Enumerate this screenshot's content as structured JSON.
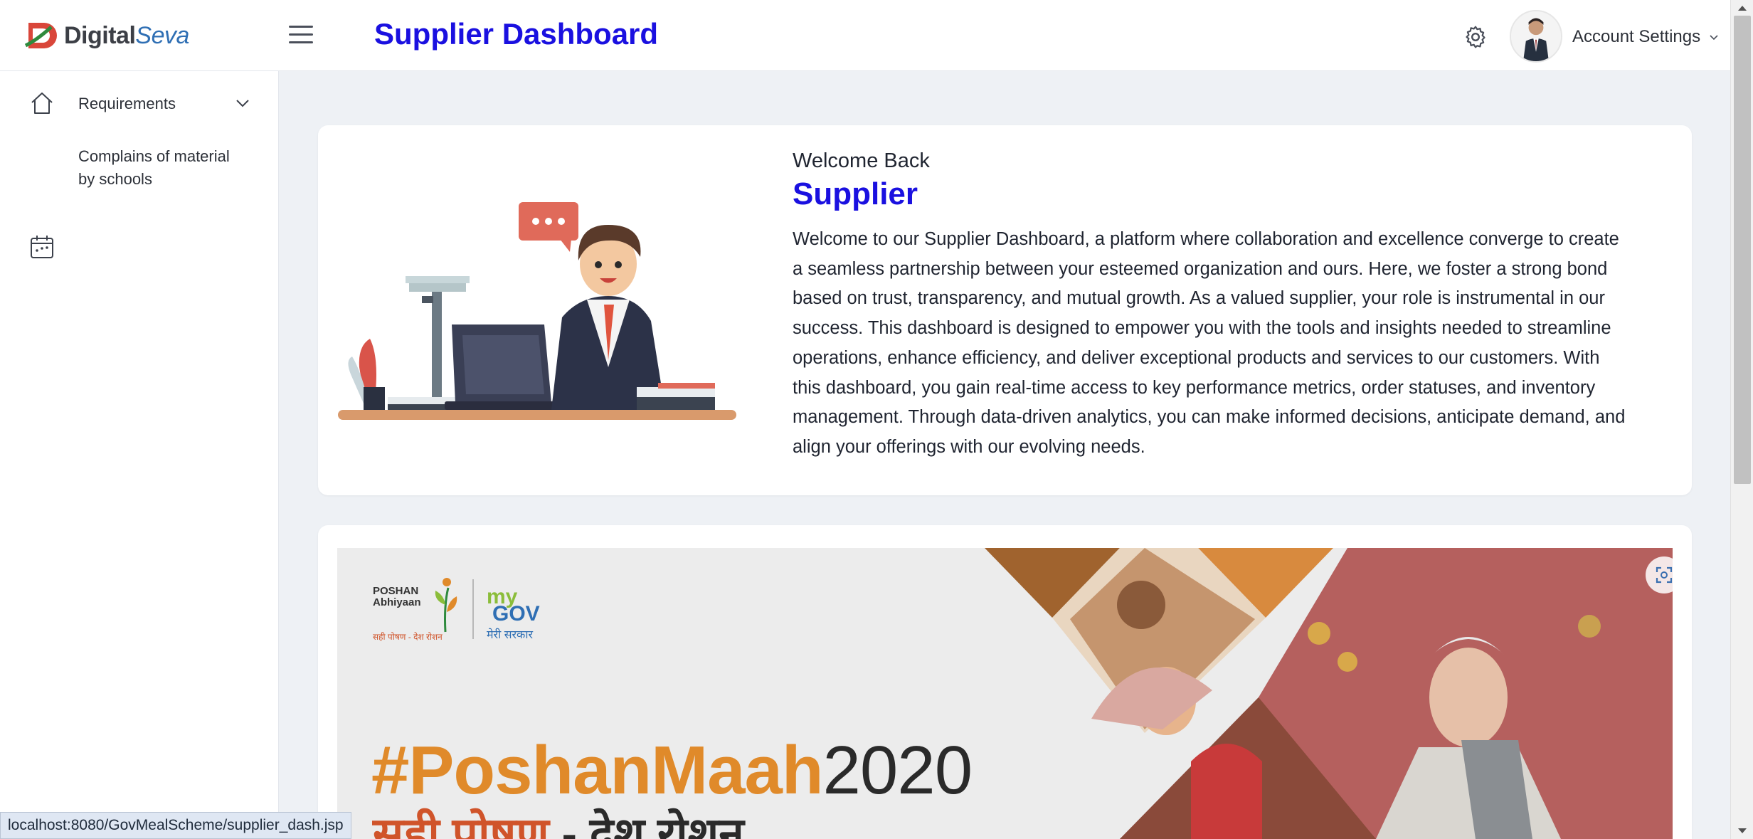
{
  "brand": {
    "name_part1": "Digital",
    "name_part2": "Seva"
  },
  "header": {
    "title": "Supplier Dashboard",
    "account_label": "Account Settings",
    "icons": [
      "menu-icon",
      "gear-icon",
      "chevron-down-icon"
    ]
  },
  "sidebar": {
    "items": [
      {
        "label": "Requirements",
        "icon": "home-icon",
        "has_caret": true
      },
      {
        "label_line1": "Complains of material",
        "label_line2": "by schools",
        "icon": "calendar-icon"
      }
    ]
  },
  "welcome": {
    "greeting": "Welcome Back",
    "role": "Supplier",
    "lines": [
      "Welcome to our Supplier Dashboard, a platform where collaboration and excellence converge to create",
      "a seamless partnership between your esteemed organization and ours. Here, we foster a strong bond",
      "based on trust, transparency, and mutual growth. As a valued supplier, your role is instrumental in our",
      "success. This dashboard is designed to empower you with the tools and insights needed to streamline",
      "operations, enhance efficiency, and deliver exceptional products and services to our customers. With",
      "this dashboard, you gain real-time access to key performance metrics, order statuses, and inventory",
      "management. Through data-driven analytics, you can make informed decisions, anticipate demand, and",
      "align your offerings with our evolving needs."
    ]
  },
  "banner": {
    "logo_poshan": "POSHAN",
    "logo_abhiyaan": "Abhiyaan",
    "logo_tagline": "सही पोषण - देश रोशन",
    "logo_mygov_my": "my",
    "logo_mygov_gov": "GOV",
    "logo_mygov_hindi": "मेरी सरकार",
    "title_hashtag": "#PoshanMaah",
    "title_year": "2020",
    "subtitle_part1": "सही पोषण",
    "subtitle_dash": " - ",
    "subtitle_part2": "देश रोशन"
  },
  "statusbar": {
    "url": "localhost:8080/GovMealScheme/supplier_dash.jsp"
  },
  "colors": {
    "accent": "#1a10e0",
    "banner_orange": "#e08a2a",
    "logo_red": "#d9463a",
    "logo_green": "#2e8a3d"
  }
}
